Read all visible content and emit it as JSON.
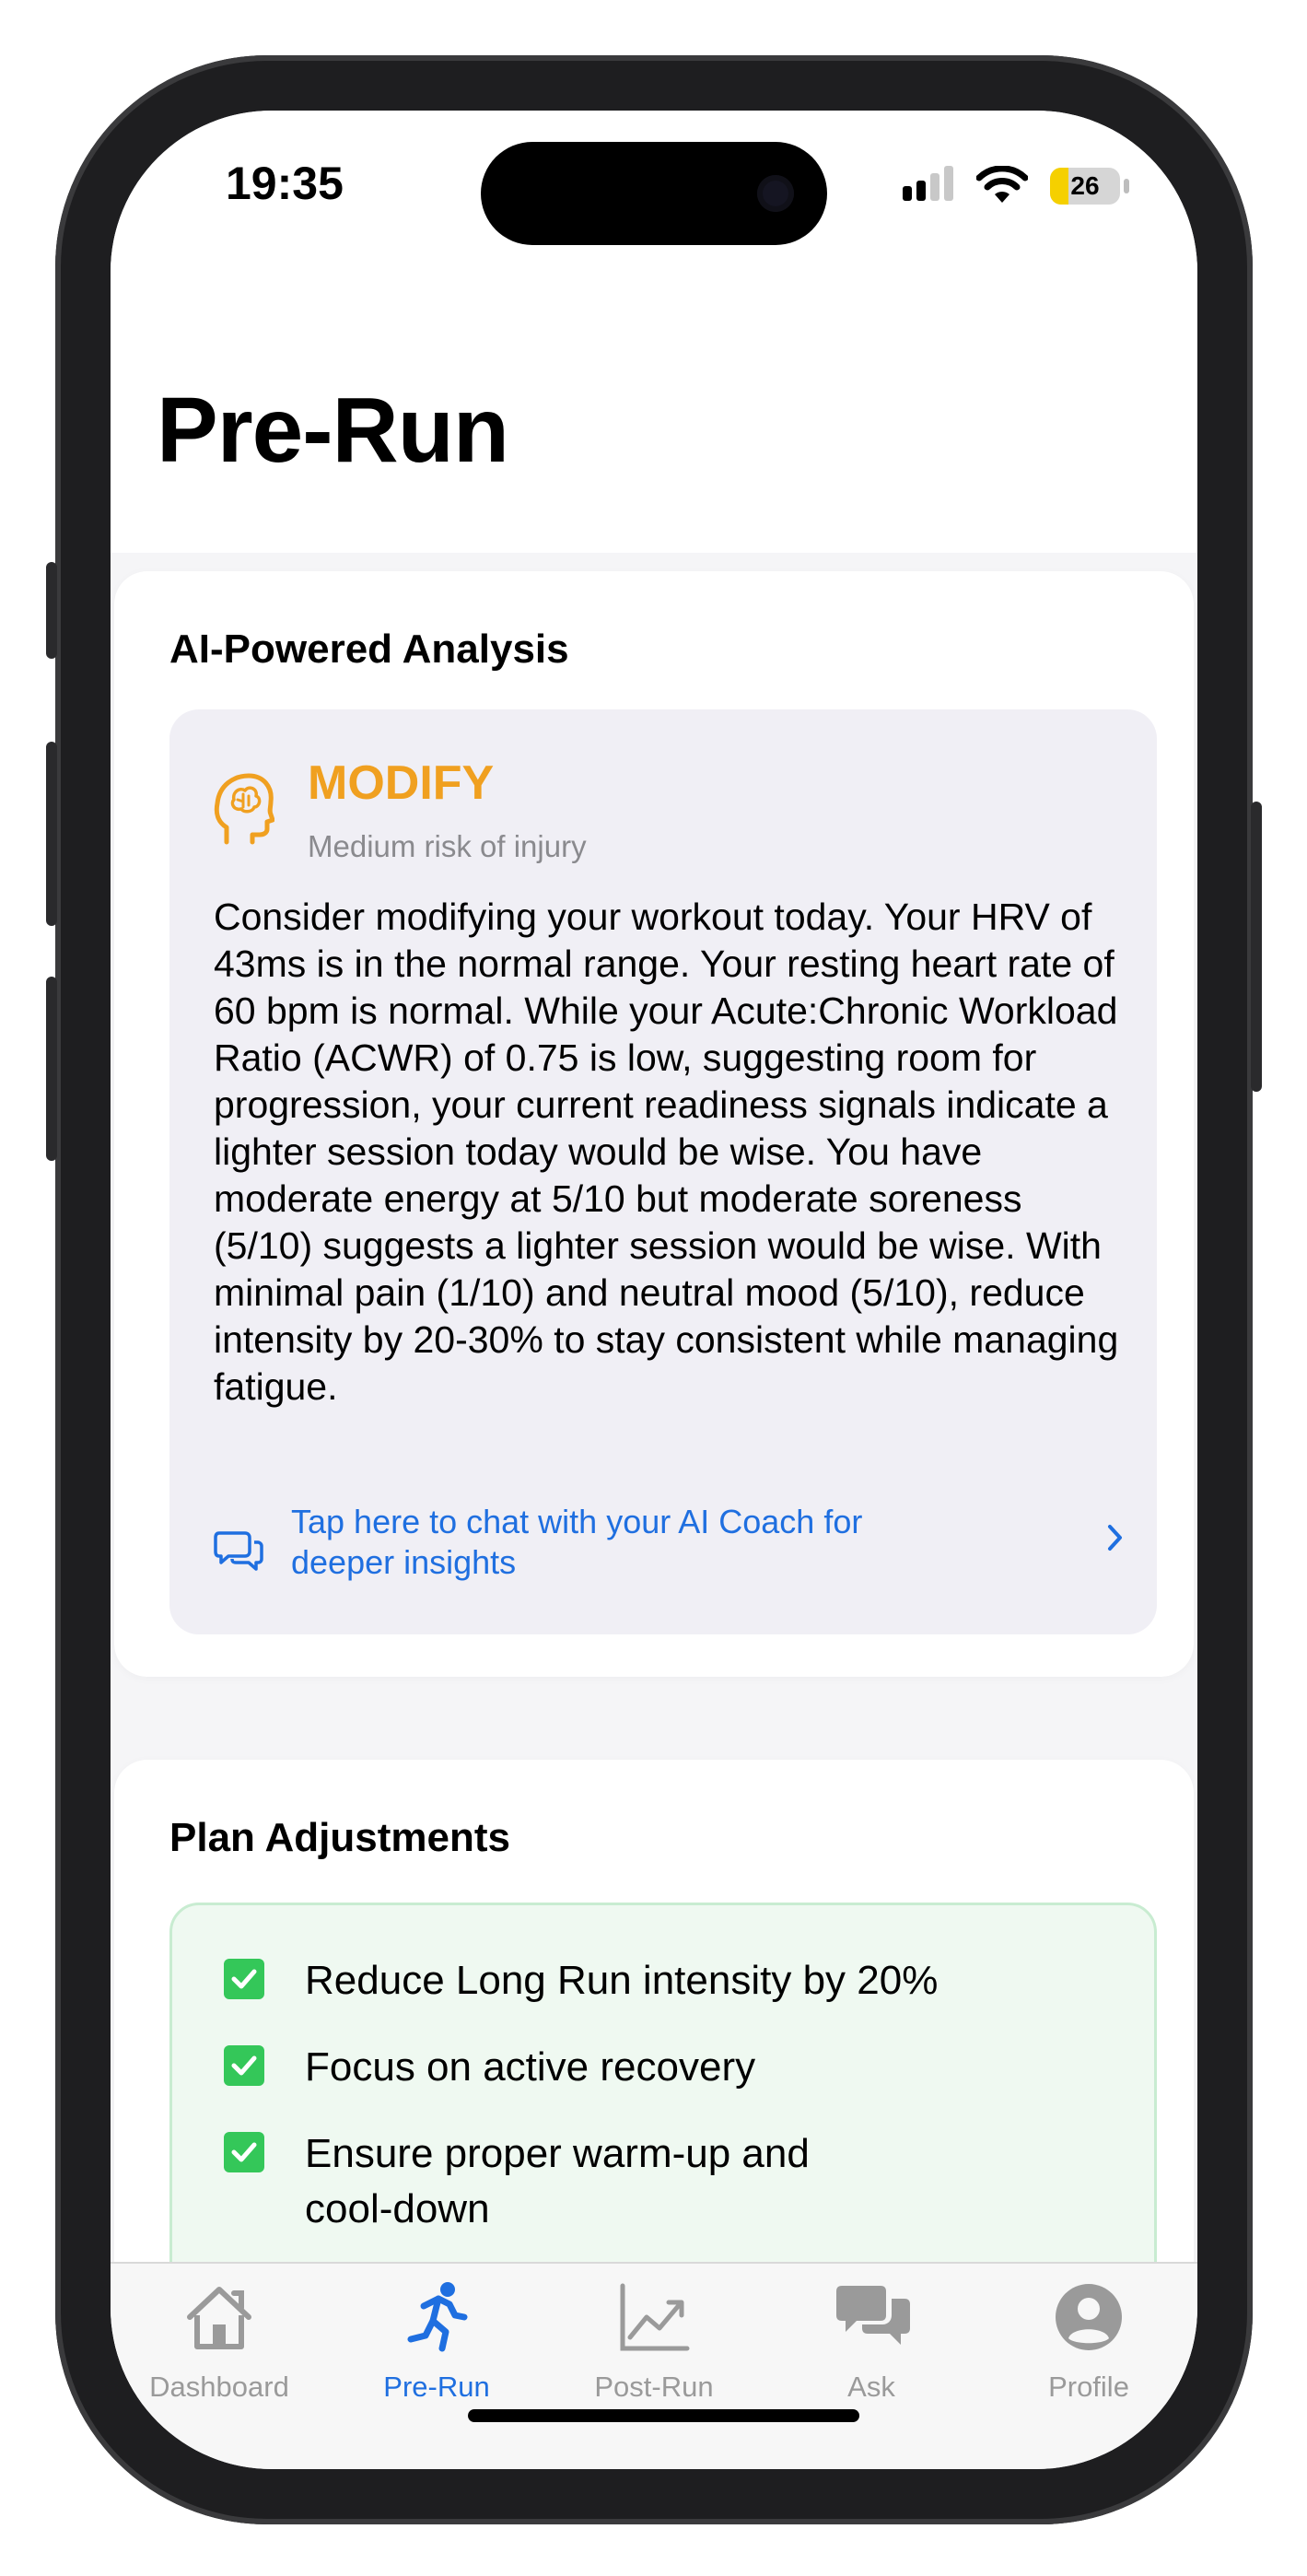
{
  "status_bar": {
    "time": "19:35",
    "battery_percent": "26",
    "battery_level": 0.26
  },
  "page": {
    "title": "Pre-Run"
  },
  "analysis": {
    "title": "AI-Powered Analysis",
    "recommendation": "MODIFY",
    "risk": "Medium risk of injury",
    "recommendation_color": "#f0a020",
    "icon": "brain-head-icon",
    "text": "Consider modifying your workout today. Your HRV of 43ms is in the normal range. Your resting heart rate of 60 bpm is normal. While your Acute:Chronic Workload Ratio (ACWR) of 0.75 is low, suggesting room for progression, your current readiness signals indicate a lighter session today would be wise. You have moderate energy at 5/10 but moderate soreness (5/10) suggests a lighter session would be wise. With minimal pain (1/10) and neutral mood (5/10), reduce intensity by 20-30% to stay consistent while managing fatigue.",
    "chat_link": "Tap here to chat with your AI Coach for deeper insights",
    "link_color": "#1f6fe0"
  },
  "plan_adjustments": {
    "title": "Plan Adjustments",
    "items": [
      {
        "label": "Reduce Long Run intensity by 20%",
        "checked": true
      },
      {
        "label": "Focus on active recovery",
        "checked": true
      },
      {
        "label": "Ensure proper warm-up and cool-down",
        "checked": true
      }
    ],
    "check_color": "#34c759"
  },
  "tab_bar": {
    "active": "Pre-Run",
    "tabs": [
      {
        "label": "Dashboard",
        "icon": "house-icon"
      },
      {
        "label": "Pre-Run",
        "icon": "running-figure-icon"
      },
      {
        "label": "Post-Run",
        "icon": "line-chart-icon"
      },
      {
        "label": "Ask",
        "icon": "chat-bubbles-icon"
      },
      {
        "label": "Profile",
        "icon": "person-circle-icon"
      }
    ]
  }
}
